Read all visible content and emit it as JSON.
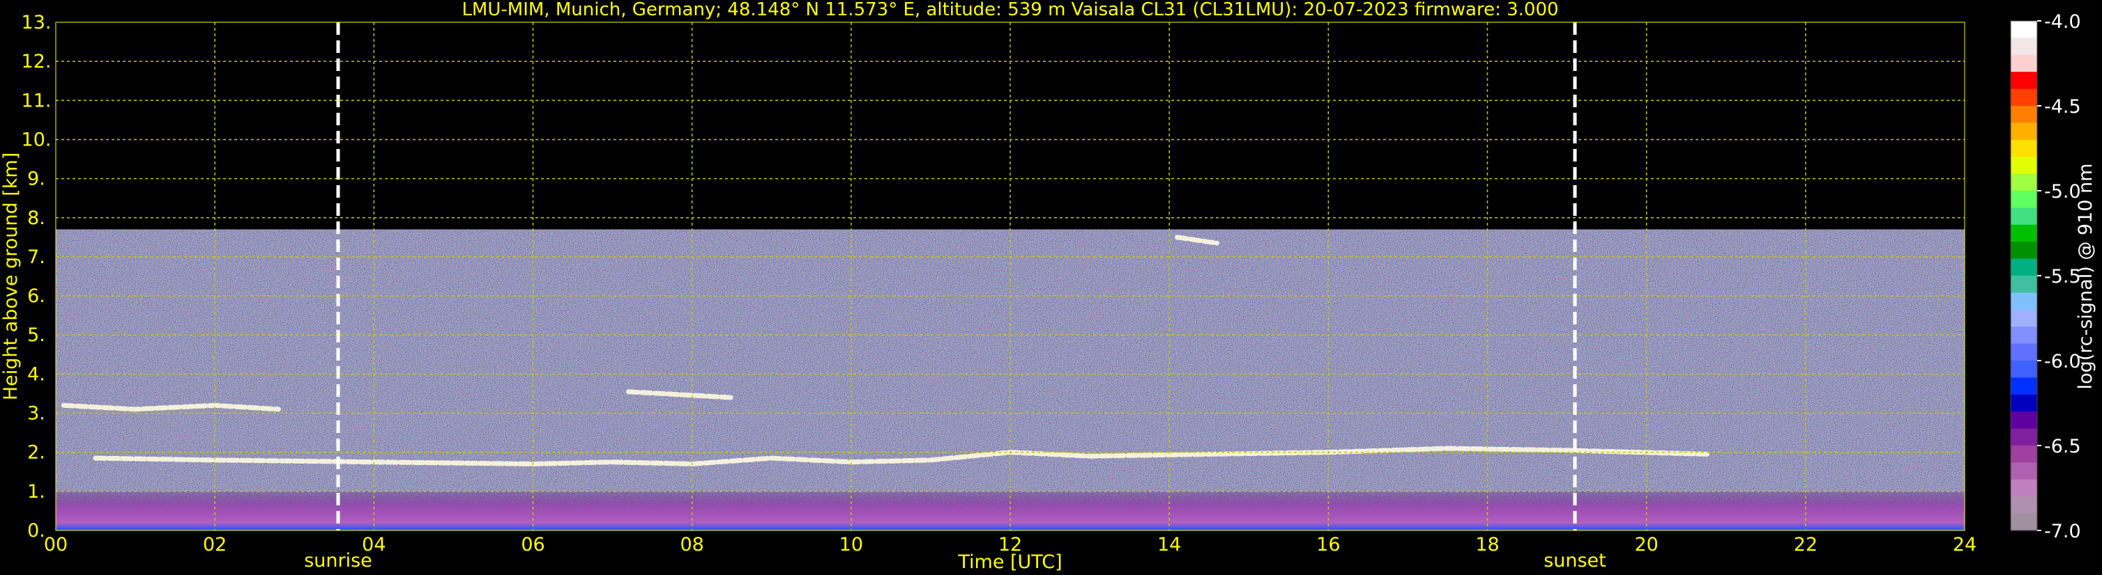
{
  "chart_data": {
    "type": "heatmap",
    "title": "LMU-MIM, Munich, Germany; 48.148° N 11.573° E, altitude: 539 m    Vaisala CL31 (CL31LMU): 20-07-2023    firmware: 3.000",
    "xlabel": "Time [UTC]",
    "ylabel": "Height above ground [km]",
    "xlim": [
      0,
      24
    ],
    "ylim": [
      0,
      13
    ],
    "x_ticks": [
      "00",
      "02",
      "04",
      "06",
      "08",
      "10",
      "12",
      "14",
      "16",
      "18",
      "20",
      "22",
      "24"
    ],
    "x_tick_values": [
      0,
      2,
      4,
      6,
      8,
      10,
      12,
      14,
      16,
      18,
      20,
      22,
      24
    ],
    "y_ticks": [
      "0.",
      "1.",
      "2.",
      "3.",
      "4.",
      "5.",
      "6.",
      "7.",
      "8.",
      "9.",
      "10.",
      "11.",
      "12.",
      "13."
    ],
    "y_tick_values": [
      0,
      1,
      2,
      3,
      4,
      5,
      6,
      7,
      8,
      9,
      10,
      11,
      12,
      13
    ],
    "grid": true,
    "signal_top_km": 7.7,
    "events": [
      {
        "label": "sunrise",
        "time": 3.55
      },
      {
        "label": "sunset",
        "time": 19.1
      }
    ],
    "colorbar": {
      "label": "log(rc-signal) @ 910 nm",
      "range": [
        -7.0,
        -4.0
      ],
      "ticks": [
        "-4.0",
        "-4.5",
        "-5.0",
        "-5.5",
        "-6.0",
        "-6.5",
        "-7.0"
      ],
      "tick_values": [
        -4.0,
        -4.5,
        -5.0,
        -5.5,
        -6.0,
        -6.5,
        -7.0
      ],
      "colors": [
        "#ffffff",
        "#f2e6e6",
        "#ffd0d0",
        "#ff0000",
        "#ff4000",
        "#ff8000",
        "#ffb000",
        "#ffe000",
        "#e0ff00",
        "#a0ff40",
        "#60ff60",
        "#40e080",
        "#00c000",
        "#009000",
        "#00b080",
        "#40c0a0",
        "#80c0ff",
        "#a0b0ff",
        "#8090ff",
        "#6070ff",
        "#4060ff",
        "#0030ff",
        "#0000c0",
        "#6000a0",
        "#8020a0",
        "#a040a0",
        "#b060b0",
        "#c080c0",
        "#b090b0",
        "#a090a0"
      ]
    },
    "layers": [
      {
        "desc": "boundary layer base",
        "top_km": 1.0
      },
      {
        "desc": "cloud layer",
        "points": [
          [
            0.5,
            1.85
          ],
          [
            2,
            1.8
          ],
          [
            4,
            1.75
          ],
          [
            6,
            1.7
          ],
          [
            7,
            1.75
          ],
          [
            8,
            1.7
          ],
          [
            9,
            1.85
          ],
          [
            10,
            1.75
          ],
          [
            11,
            1.8
          ],
          [
            12,
            2.0
          ],
          [
            13,
            1.9
          ],
          [
            16,
            2.0
          ],
          [
            17.5,
            2.1
          ],
          [
            19,
            2.05
          ],
          [
            20.8,
            1.95
          ]
        ]
      },
      {
        "desc": "residual layer",
        "points": [
          [
            0.1,
            3.2
          ],
          [
            1,
            3.1
          ],
          [
            2,
            3.2
          ],
          [
            2.8,
            3.1
          ]
        ]
      },
      {
        "desc": "elevated cloud",
        "points": [
          [
            7.2,
            3.55
          ],
          [
            8.5,
            3.4
          ]
        ]
      },
      {
        "desc": "high cloud",
        "points": [
          [
            14.1,
            7.5
          ],
          [
            14.6,
            7.35
          ]
        ]
      }
    ]
  }
}
